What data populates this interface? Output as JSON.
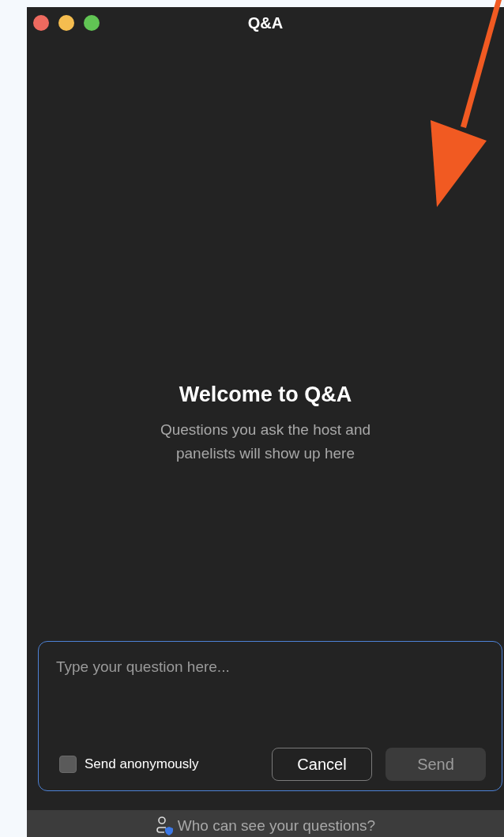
{
  "window": {
    "title": "Q&A",
    "controls": [
      {
        "kind": "close"
      },
      {
        "kind": "minimize"
      },
      {
        "kind": "zoom"
      }
    ]
  },
  "welcome": {
    "heading": "Welcome to Q&A",
    "text": "Questions you ask the host and panelists will show up here"
  },
  "compose": {
    "placeholder": "Type your question here...",
    "anonymous": {
      "label": "Send anonymously",
      "checked": false
    },
    "buttons": [
      {
        "kind": "cancel",
        "label": "Cancel",
        "disabled": false
      },
      {
        "kind": "send",
        "label": "Send",
        "disabled": true
      }
    ]
  },
  "footer": {
    "link": "Who can see your questions?"
  },
  "annotation": {
    "kind": "arrow"
  }
}
